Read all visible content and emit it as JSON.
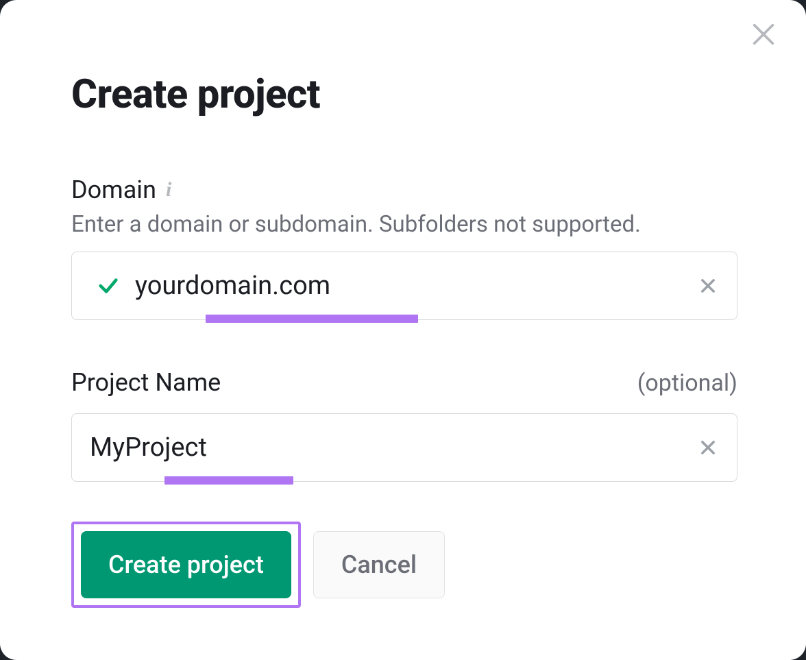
{
  "dialog": {
    "title": "Create project",
    "close_icon": "close-icon"
  },
  "domain_field": {
    "label": "Domain",
    "info_icon": "info-icon",
    "help": "Enter a domain or subdomain. Subfolders not supported.",
    "value": "yourdomain.com",
    "validated": true,
    "clear_icon": "clear-icon"
  },
  "project_name_field": {
    "label": "Project Name",
    "optional_text": "(optional)",
    "value": "MyProject",
    "clear_icon": "clear-icon"
  },
  "buttons": {
    "create_label": "Create project",
    "cancel_label": "Cancel"
  },
  "annotation": {
    "highlight_color": "#b075f2"
  }
}
